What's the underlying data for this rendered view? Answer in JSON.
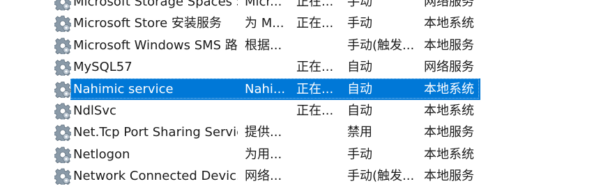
{
  "accent": "#0078d7",
  "icon": "service-gear-icon",
  "services": [
    {
      "name": "Microsoft Storage Spaces S...",
      "description": "Micr...",
      "status": "正在...",
      "startup": "手动",
      "logon": "网络服务",
      "selected": false
    },
    {
      "name": "Microsoft Store 安装服务",
      "description": "为 M...",
      "status": "正在...",
      "startup": "手动",
      "logon": "本地系统",
      "selected": false
    },
    {
      "name": "Microsoft Windows SMS 路...",
      "description": "根据...",
      "status": "",
      "startup": "手动(触发...",
      "logon": "本地服务",
      "selected": false
    },
    {
      "name": "MySQL57",
      "description": "",
      "status": "正在...",
      "startup": "自动",
      "logon": "网络服务",
      "selected": false
    },
    {
      "name": "Nahimic service",
      "description": "Nahi...",
      "status": "正在...",
      "startup": "自动",
      "logon": "本地系统",
      "selected": true
    },
    {
      "name": "NdlSvc",
      "description": "",
      "status": "正在...",
      "startup": "自动",
      "logon": "本地系统",
      "selected": false
    },
    {
      "name": "Net.Tcp Port Sharing Service",
      "description": "提供...",
      "status": "",
      "startup": "禁用",
      "logon": "本地服务",
      "selected": false
    },
    {
      "name": "Netlogon",
      "description": "为用...",
      "status": "",
      "startup": "手动",
      "logon": "本地系统",
      "selected": false
    },
    {
      "name": "Network Connected Devic...",
      "description": "网络...",
      "status": "",
      "startup": "手动(触发...",
      "logon": "本地服务",
      "selected": false
    }
  ]
}
